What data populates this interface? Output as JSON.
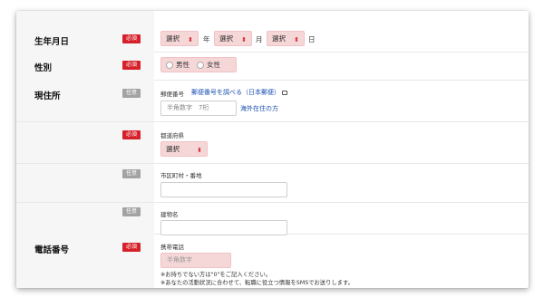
{
  "badges": {
    "required": "必須",
    "optional": "任意"
  },
  "birthdate": {
    "label": "生年月日",
    "year": {
      "value": "選択",
      "unit": "年"
    },
    "month": {
      "value": "選択",
      "unit": "月"
    },
    "day": {
      "value": "選択",
      "unit": "日"
    }
  },
  "gender": {
    "label": "性別",
    "options": [
      "男性",
      "女性"
    ]
  },
  "address": {
    "label": "現住所",
    "postal": {
      "title": "郵便番号",
      "lookup_link": "郵便番号を調べる（日本郵便）",
      "placeholder": "半角数字　7桁",
      "overseas_link": "海外在住の方"
    },
    "prefecture": {
      "title": "都道府県",
      "value": "選択"
    },
    "city": {
      "title": "市区町村・番地",
      "value": ""
    },
    "building": {
      "title": "建物名",
      "value": ""
    }
  },
  "phone": {
    "label": "電話番号",
    "mobile_title": "携帯電話",
    "placeholder": "半角数字",
    "notes": [
      "※お持ちでない方は\"0\"をご記入ください。",
      "※あなたの活動状況に合わせて、転職に役立つ情報をSMSでお送りします。"
    ]
  },
  "colors": {
    "required": "#d6212a",
    "optional": "#a3a3a3",
    "field_pink": "#f6d7d8",
    "link": "#1b4fb0"
  }
}
